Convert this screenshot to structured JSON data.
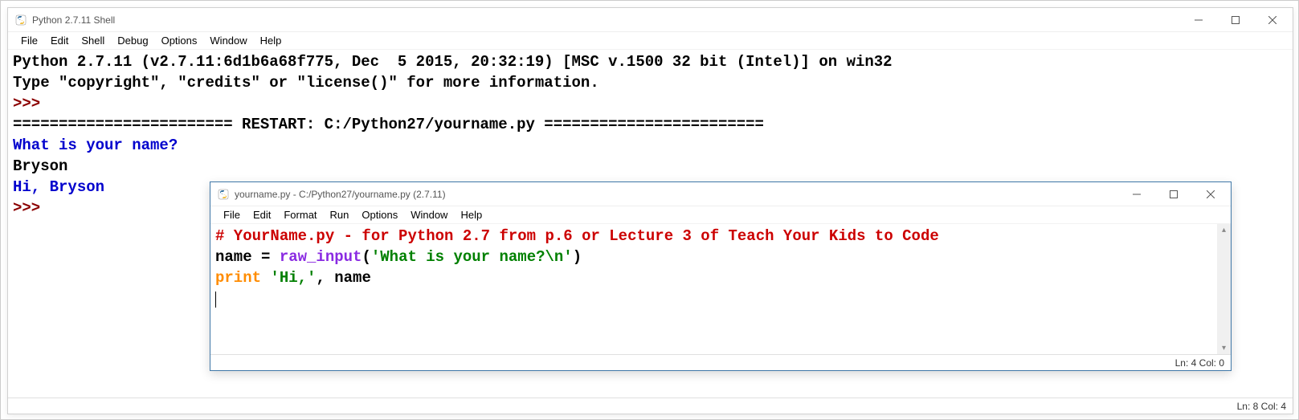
{
  "shell": {
    "title": "Python 2.7.11 Shell",
    "menu": [
      "File",
      "Edit",
      "Shell",
      "Debug",
      "Options",
      "Window",
      "Help"
    ],
    "line_version": "Python 2.7.11 (v2.7.11:6d1b6a68f775, Dec  5 2015, 20:32:19) [MSC v.1500 32 bit (Intel)] on win32",
    "line_info": "Type \"copyright\", \"credits\" or \"license()\" for more information.",
    "prompt": ">>>",
    "restart_line": "======================== RESTART: C:/Python27/yourname.py ========================",
    "q_line": "What is your name?",
    "input_line": "Bryson",
    "out_line": "Hi, Bryson",
    "status": "Ln: 8  Col: 4"
  },
  "editor": {
    "title": "yourname.py - C:/Python27/yourname.py (2.7.11)",
    "menu": [
      "File",
      "Edit",
      "Format",
      "Run",
      "Options",
      "Window",
      "Help"
    ],
    "code": {
      "comment": "# YourName.py - for Python 2.7 from p.6 or Lecture 3 of Teach Your Kids to Code",
      "l2_name": "name ",
      "l2_eq": "= ",
      "l2_func": "raw_input",
      "l2_paren_open": "(",
      "l2_str": "'What is your name?\\n'",
      "l2_paren_close": ")",
      "l3_print": "print",
      "l3_sp": " ",
      "l3_str": "'Hi,'",
      "l3_rest": ", name"
    },
    "status": "Ln: 4  Col: 0"
  }
}
